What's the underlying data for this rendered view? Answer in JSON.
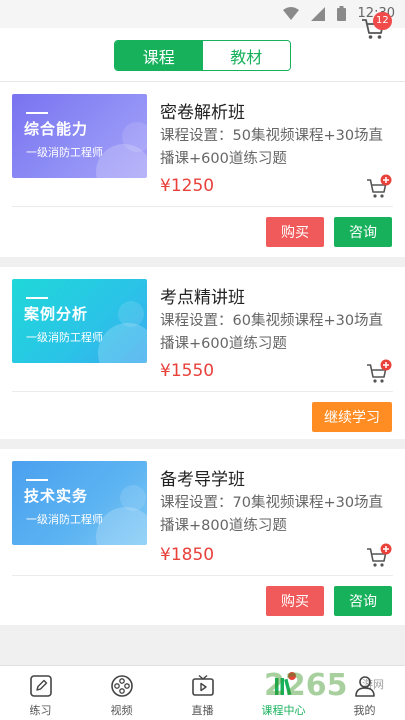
{
  "status_bar": {
    "time": "12:30"
  },
  "header": {
    "tabs": [
      {
        "label": "课程",
        "active": true
      },
      {
        "label": "教材",
        "active": false
      }
    ],
    "cart_badge": "12"
  },
  "courses": [
    {
      "thumb_title": "综合能力",
      "thumb_subtitle": "一级消防工程师",
      "title": "密卷解析班",
      "desc": "课程设置：50集视频课程+30场直播课+600道练习题",
      "price": "¥1250",
      "buttons": [
        {
          "label": "购买",
          "color": "#f05a5a"
        },
        {
          "label": "咨询",
          "color": "#17b15c"
        }
      ]
    },
    {
      "thumb_title": "案例分析",
      "thumb_subtitle": "一级消防工程师",
      "title": "考点精讲班",
      "desc": "课程设置：60集视频课程+30场直播课+600道练习题",
      "price": "¥1550",
      "buttons": [
        {
          "label": "继续学习",
          "color": "#ff8d24"
        }
      ]
    },
    {
      "thumb_title": "技术实务",
      "thumb_subtitle": "一级消防工程师",
      "title": "备考导学班",
      "desc": "课程设置：70集视频课程+30场直播课+800道练习题",
      "price": "¥1850",
      "buttons": [
        {
          "label": "购买",
          "color": "#f05a5a"
        },
        {
          "label": "咨询",
          "color": "#17b15c"
        }
      ]
    }
  ],
  "tabbar": {
    "items": [
      {
        "label": "练习",
        "icon": "pencil-icon"
      },
      {
        "label": "视频",
        "icon": "film-reel-icon"
      },
      {
        "label": "直播",
        "icon": "tv-play-icon"
      },
      {
        "label": "课程中心",
        "icon": "books-icon",
        "active": true
      },
      {
        "label": "我的",
        "icon": "person-icon"
      }
    ]
  },
  "watermark": {
    "main": "2265",
    "sub": "游网"
  },
  "colors": {
    "accent": "#17b15c",
    "price": "#e8413a",
    "buy": "#f05a5a",
    "continue": "#ff8d24"
  }
}
